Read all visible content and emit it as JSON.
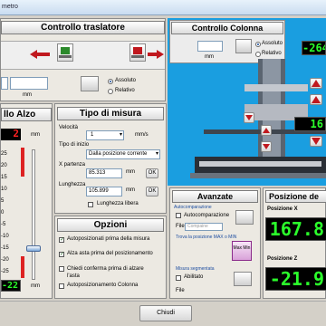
{
  "window": {
    "title_fragment": "metro"
  },
  "traslatore": {
    "title": "Controllo traslatore",
    "unit": "mm",
    "mode_options": [
      "Assoluto",
      "Relativo"
    ],
    "selected_mode": "Assoluto"
  },
  "colonna": {
    "title": "Controllo Colonna",
    "unit": "mm",
    "mode_options": [
      "Assoluto",
      "Relativo"
    ],
    "selected_mode": "Assoluto",
    "lcd_top": "-264",
    "lcd_mid": "16"
  },
  "alzo": {
    "title": "llo Alzo",
    "unit": "mm",
    "display": "2",
    "scale_ticks": [
      "25",
      "20",
      "15",
      "10",
      "5",
      "0",
      "-5",
      "-10",
      "-15",
      "-20",
      "-25"
    ],
    "bottom_display": "-22"
  },
  "tipo_misura": {
    "title": "Tipo di misura",
    "velocita_label": "Velocità",
    "velocita_value": "1",
    "velocita_unit": "mm/s",
    "tipo_inizio_label": "Tipo di inizio",
    "tipo_inizio_value": "Dalla posizione corrente",
    "x_partenza_label": "X partenza",
    "x_partenza_value": "85.313",
    "lunghezza_label": "Lunghezza",
    "lunghezza_value": "105.899",
    "unit": "mm",
    "ok_label": "OK",
    "lunghezza_libera_label": "Lunghezza libera"
  },
  "opzioni": {
    "title": "Opzioni",
    "items": [
      {
        "label": "Autoposizionati prima della misura",
        "checked": true
      },
      {
        "label": "Alza asta prima del posizionamento",
        "checked": true
      },
      {
        "label": "Chiedi conferma prima di alzare l'asta",
        "checked": false
      },
      {
        "label": "Autoposizionamento Colonna",
        "checked": false
      }
    ]
  },
  "avanzate": {
    "title": "Avanzate",
    "autocomp_section": "Autocomparazione",
    "autocomp_label": "Autocomparazione",
    "file_label": "File",
    "file_placeholder": "Compaine",
    "trova_label": "Trova la posizione MAX o MIN",
    "max_min_label": "Max Min",
    "misura_segmentata": "Misura segmentata",
    "abilitato_label": "Abilitato",
    "file2_label": "File"
  },
  "posizione": {
    "title": "Posizione de",
    "x_label": "Posizione X",
    "x_value": "167.8",
    "z_label": "Posizione Z",
    "z_value": "-21.9"
  },
  "footer": {
    "close_label": "Chiudi"
  }
}
